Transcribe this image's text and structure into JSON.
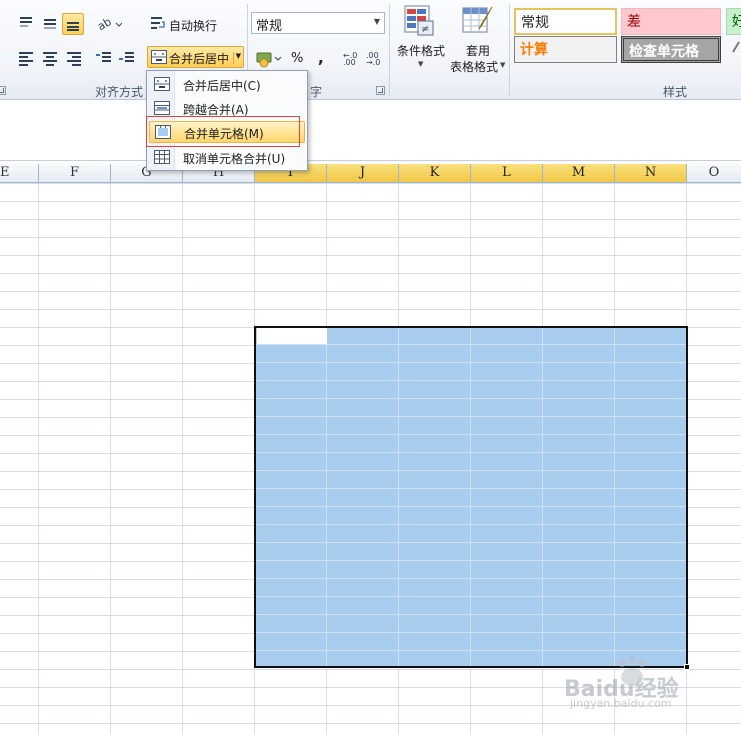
{
  "ribbon": {
    "wrap_text_label": "自动换行",
    "merge_center_label": "合并后居中",
    "number_format_value": "常规",
    "percent_label": "%",
    "comma_label": ",",
    "increase_decimal_label": "←.0 .00",
    "decrease_decimal_label": ".00 →.0",
    "conditional_format_label": "条件格式",
    "table_format_label_1": "套用",
    "table_format_label_2": "表格格式",
    "alignment_group_label": "对齐方式",
    "number_group_label": "字",
    "styles_group_label": "样式",
    "styles": {
      "normal": "常规",
      "bad": "差",
      "good": "好",
      "calculation": "计算",
      "check_cell": "检查单元格"
    }
  },
  "menu": {
    "items": [
      {
        "label": "合并后居中(C)",
        "icon": "merge-center-icon"
      },
      {
        "label": "跨越合并(A)",
        "icon": "merge-across-icon"
      },
      {
        "label": "合并单元格(M)",
        "icon": "merge-cells-icon"
      },
      {
        "label": "取消单元格合并(U)",
        "icon": "unmerge-cells-icon"
      }
    ],
    "highlighted_index": 2
  },
  "columns": [
    "E",
    "F",
    "G",
    "H",
    "I",
    "J",
    "K",
    "L",
    "M",
    "N",
    "O"
  ],
  "selected_columns": [
    "I",
    "J",
    "K",
    "L",
    "M",
    "N"
  ],
  "watermark": {
    "brand": "Baidu经验",
    "url": "jingyan.baidu.com"
  },
  "colors": {
    "selection": "#a8cdee",
    "header_selected": "#f2c746",
    "menu_hot": "#ffd66b",
    "highlight_box": "#d6473c",
    "style_bad_bg": "#ffc7ce",
    "style_good_bg": "#c6efce",
    "style_calc_text": "#fa7d00"
  }
}
